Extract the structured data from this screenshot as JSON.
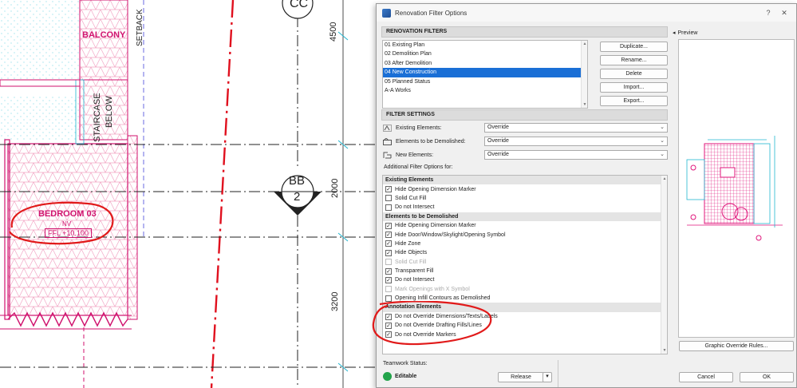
{
  "cad": {
    "grid_label_cc": "CC",
    "grid_label_bb": "BB",
    "grid_number_bb": "2",
    "dim_4500": "4500",
    "dim_2000": "2000",
    "dim_3200": "3200",
    "balcony": "BALCONY",
    "setback": "SETBACK",
    "staircase_line1": "STAIRCASE",
    "staircase_line2": "BELOW",
    "bedroom": "BEDROOM 03",
    "bedroom_nv": "NV",
    "bedroom_ffl": "FFL +10.100"
  },
  "dialog": {
    "title": "Renovation Filter Options",
    "help": "?",
    "close": "✕",
    "renovation_filters_header": "RENOVATION FILTERS",
    "filters": [
      {
        "label": "01 Existing Plan",
        "selected": false
      },
      {
        "label": "02 Demolition Plan",
        "selected": false
      },
      {
        "label": "03 After Demolition",
        "selected": false
      },
      {
        "label": "04 New Construction",
        "selected": true
      },
      {
        "label": "05 Planned Status",
        "selected": false
      },
      {
        "label": "A-A Works",
        "selected": false
      }
    ],
    "buttons": {
      "duplicate": "Duplicate...",
      "rename": "Rename...",
      "delete": "Delete",
      "import": "Import...",
      "export": "Export..."
    },
    "filter_settings_header": "FILTER SETTINGS",
    "settings": {
      "existing_label": "Existing Elements:",
      "existing_value": "Override",
      "demolished_label": "Elements to be Demolished:",
      "demolished_value": "Override",
      "new_label": "New Elements:",
      "new_value": "Override"
    },
    "additional_label": "Additional Filter Options for:",
    "groups": [
      {
        "name": "Existing Elements",
        "options": [
          {
            "label": "Hide Opening Dimension Marker",
            "checked": true,
            "disabled": false
          },
          {
            "label": "Solid Cut Fill",
            "checked": false,
            "disabled": false
          },
          {
            "label": "Do not Intersect",
            "checked": false,
            "disabled": false
          }
        ]
      },
      {
        "name": "Elements to be Demolished",
        "options": [
          {
            "label": "Hide Opening Dimension Marker",
            "checked": true,
            "disabled": false
          },
          {
            "label": "Hide Door/Window/Skylight/Opening Symbol",
            "checked": true,
            "disabled": false
          },
          {
            "label": "Hide Zone",
            "checked": true,
            "disabled": false
          },
          {
            "label": "Hide Objects",
            "checked": true,
            "disabled": false
          },
          {
            "label": "Solid Cut Fill",
            "checked": false,
            "disabled": true
          },
          {
            "label": "Transparent Fill",
            "checked": true,
            "disabled": false
          },
          {
            "label": "Do not Intersect",
            "checked": true,
            "disabled": false
          },
          {
            "label": "Mark Openings with X Symbol",
            "checked": false,
            "disabled": true
          },
          {
            "label": "Opening Infill Contours as Demolished",
            "checked": false,
            "disabled": false
          }
        ]
      },
      {
        "name": "Annotation Elements",
        "options": [
          {
            "label": "Do not Override Dimensions/Texts/Labels",
            "checked": true,
            "disabled": false
          },
          {
            "label": "Do not Override Drafting Fills/Lines",
            "checked": true,
            "disabled": false
          },
          {
            "label": "Do not Override Markers",
            "checked": true,
            "disabled": false
          }
        ]
      }
    ],
    "preview_label": "Preview",
    "graphic_override_button": "Graphic Override Rules...",
    "teamwork_label": "Teamwork Status:",
    "teamwork_status": "Editable",
    "release_button": "Release",
    "cancel_button": "Cancel",
    "ok_button": "OK"
  },
  "colors": {
    "cad_magenta": "#d0126e",
    "cad_hatch": "#f3a8c6",
    "cad_cyan": "#21b6d1",
    "cad_red": "#e0101e",
    "selection_blue": "#1a6fd6",
    "status_green": "#22a34a",
    "annotation_red": "#e11a1a"
  }
}
